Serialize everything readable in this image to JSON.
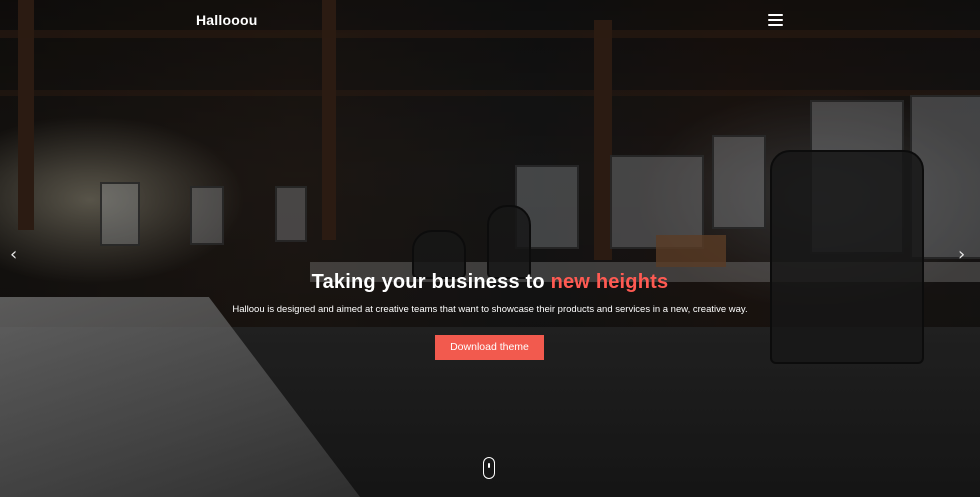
{
  "header": {
    "brand": "Hallooou",
    "menu_icon": "hamburger-menu-icon"
  },
  "slider": {
    "prev_icon": "chevron-left-icon",
    "next_icon": "chevron-right-icon",
    "prev_glyph": "‹",
    "next_glyph": "›"
  },
  "hero": {
    "title_main": "Taking your business to ",
    "title_accent": "new heights",
    "subtitle": "Halloou is designed and aimed at creative teams that want to showcase their products and services in a new, creative way.",
    "cta_label": "Download theme",
    "scroll_icon": "mouse-scroll-icon"
  },
  "colors": {
    "accent": "#f25a4e",
    "text": "#ffffff"
  }
}
